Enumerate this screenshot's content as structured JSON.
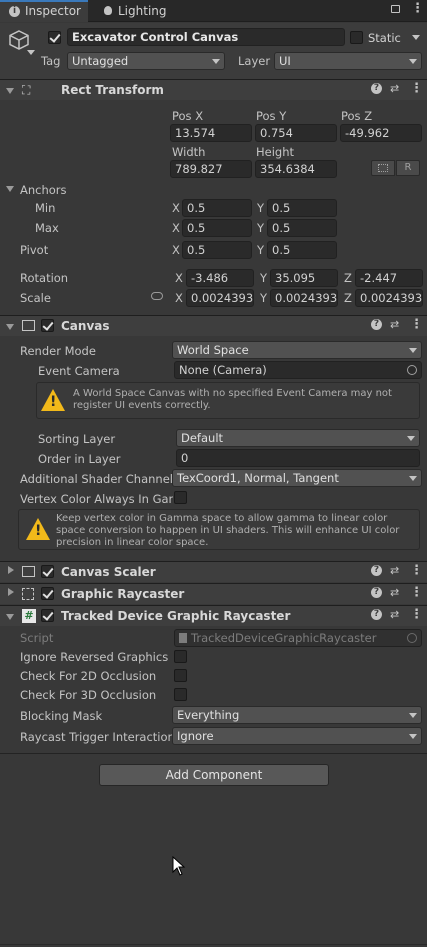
{
  "tabs": {
    "inspector": "Inspector",
    "lighting": "Lighting"
  },
  "gameobject": {
    "name": "Excavator Control Canvas",
    "static_label": "Static",
    "tag_label": "Tag",
    "tag_value": "Untagged",
    "layer_label": "Layer",
    "layer_value": "UI"
  },
  "rect_transform": {
    "title": "Rect Transform",
    "pos_x_label": "Pos X",
    "pos_y_label": "Pos Y",
    "pos_z_label": "Pos Z",
    "pos_x": "13.574",
    "pos_y": "0.754",
    "pos_z": "-49.962",
    "width_label": "Width",
    "height_label": "Height",
    "width": "789.827",
    "height": "354.6384",
    "r_button": "R",
    "anchors_label": "Anchors",
    "min_label": "Min",
    "max_label": "Max",
    "anchor_min_x": "0.5",
    "anchor_min_y": "0.5",
    "anchor_max_x": "0.5",
    "anchor_max_y": "0.5",
    "pivot_label": "Pivot",
    "pivot_x": "0.5",
    "pivot_y": "0.5",
    "rotation_label": "Rotation",
    "rot_x": "-3.486",
    "rot_y": "35.095",
    "rot_z": "-2.447",
    "scale_label": "Scale",
    "scale_x": "0.0024393",
    "scale_y": "0.0024393",
    "scale_z": "0.0024393",
    "x": "X",
    "y": "Y",
    "z": "Z"
  },
  "canvas": {
    "title": "Canvas",
    "render_mode_label": "Render Mode",
    "render_mode": "World Space",
    "event_camera_label": "Event Camera",
    "event_camera": "None (Camera)",
    "warning": "A World Space Canvas with no specified Event Camera may not register UI events correctly.",
    "sorting_layer_label": "Sorting Layer",
    "sorting_layer": "Default",
    "order_label": "Order in Layer",
    "order": "0",
    "shader_channels_label": "Additional Shader Channels",
    "shader_channels": "TexCoord1, Normal, Tangent",
    "vertex_color_label": "Vertex Color Always In Gamma",
    "vertex_warning": "Keep vertex color in Gamma space to allow gamma to linear color space conversion to happen in UI shaders. This will enhance UI color precision in linear color space."
  },
  "canvas_scaler": {
    "title": "Canvas Scaler"
  },
  "graphic_raycaster": {
    "title": "Graphic Raycaster"
  },
  "tracked_raycaster": {
    "title": "Tracked Device Graphic Raycaster",
    "script_label": "Script",
    "script_value": "TrackedDeviceGraphicRaycaster",
    "ignore_reversed_label": "Ignore Reversed Graphics",
    "check2d_label": "Check For 2D Occlusion",
    "check3d_label": "Check For 3D Occlusion",
    "blocking_mask_label": "Blocking Mask",
    "blocking_mask": "Everything",
    "trigger_label": "Raycast Trigger Interaction",
    "trigger": "Ignore"
  },
  "add_component": "Add Component",
  "colors": {
    "accent": "#3a79bb",
    "warning": "#f2b91a",
    "background": "#383838"
  }
}
